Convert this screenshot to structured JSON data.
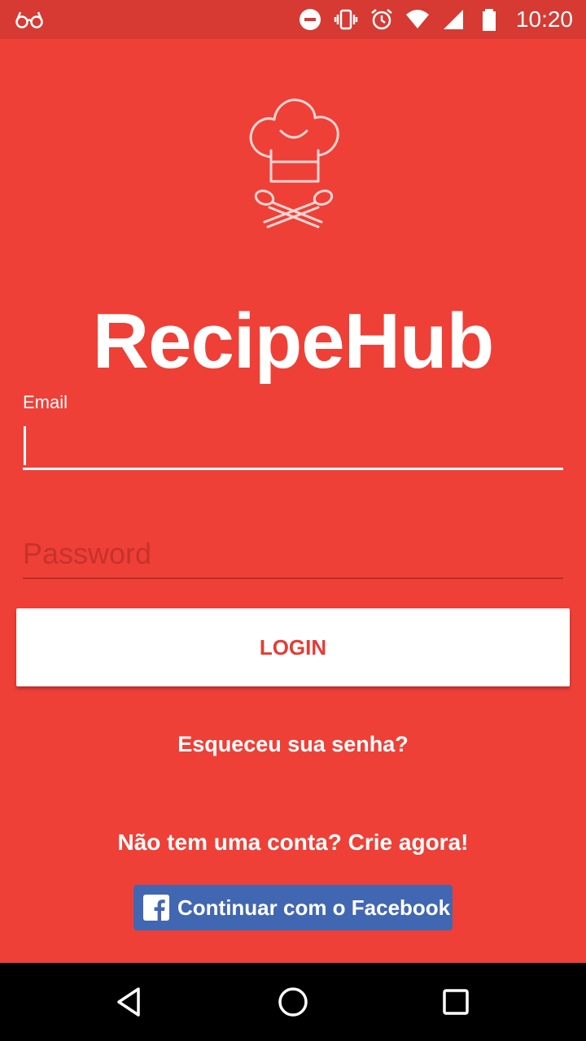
{
  "status_bar": {
    "time": "10:20",
    "icons": [
      "glasses-icon",
      "do-not-disturb-icon",
      "vibrate-icon",
      "alarm-icon",
      "wifi-icon",
      "signal-icon",
      "battery-icon"
    ]
  },
  "app": {
    "title": "RecipeHub",
    "logo": "chef-hat-spoons-icon"
  },
  "form": {
    "email_label": "Email",
    "email_value": "",
    "password_placeholder": "Password",
    "password_value": "",
    "login_label": "LOGIN"
  },
  "links": {
    "forgot_password": "Esqueceu sua senha?",
    "signup": "Não tem uma conta? Crie agora!"
  },
  "facebook": {
    "label": "Continuar com o Facebook",
    "icon": "facebook-icon"
  },
  "nav": {
    "icons": [
      "back-icon",
      "home-icon",
      "recents-icon"
    ]
  },
  "colors": {
    "background": "#EE4037",
    "status_bar": "#D63A33",
    "login_text": "#E43D34",
    "facebook": "#4267B2"
  }
}
